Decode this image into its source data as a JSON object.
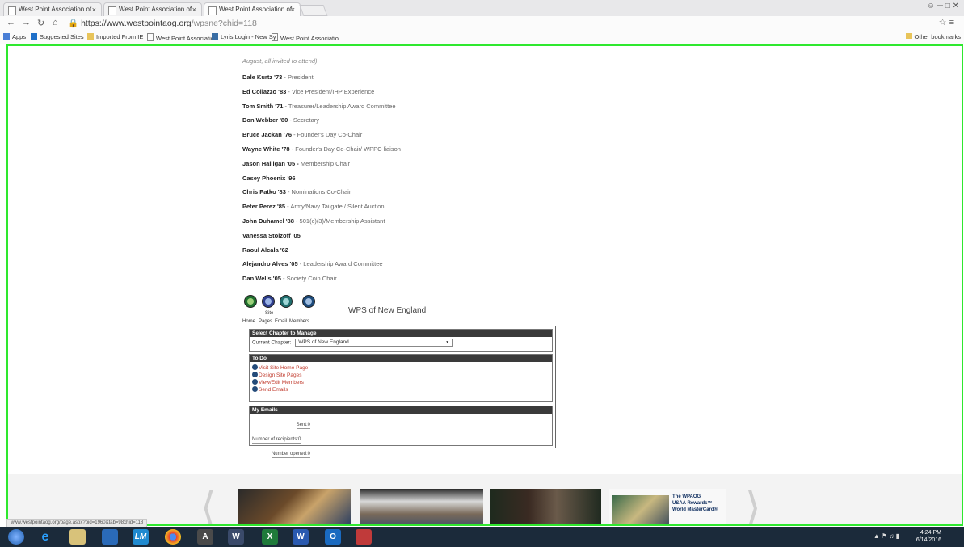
{
  "browser": {
    "tabs": [
      {
        "title": "West Point Association of"
      },
      {
        "title": "West Point Association of"
      },
      {
        "title": "West Point Association of"
      }
    ],
    "tab_close": "×",
    "url": {
      "host": "https://www.westpointaog.org",
      "path": "/wpsne?chid=118"
    },
    "bookmarks": [
      {
        "label": "Apps"
      },
      {
        "label": "Suggested Sites"
      },
      {
        "label": "Imported From IE"
      },
      {
        "label": "West Point Associatio"
      },
      {
        "label": "Lyris Login - New Sy"
      },
      {
        "label": "West Point Associatio"
      }
    ],
    "other_bookmarks": "Other bookmarks"
  },
  "page": {
    "intro": "August, all invited to attend)",
    "members": [
      {
        "name": "Dale Kurtz '73",
        "role": " - President"
      },
      {
        "name": "Ed Collazzo '83",
        "role": " - Vice President/IHP Experience"
      },
      {
        "name": "Tom Smith '71",
        "role": " - Treasurer/Leadership Award Committee"
      },
      {
        "name": "Don Webber '80",
        "role": " - Secretary"
      },
      {
        "name": "Bruce Jackan '76",
        "role": " - Founder's Day Co-Chair"
      },
      {
        "name": "Wayne White '78",
        "role": " - Founder's Day Co-Chair/ WPPC liaison"
      },
      {
        "name": "Jason Halligan '05 -",
        "role": " Membership Chair"
      },
      {
        "name": "Casey Phoenix '96",
        "role": ""
      },
      {
        "name": "Chris Patko '83",
        "role": " - Nominations Co-Chair"
      },
      {
        "name": "Peter Perez '85",
        "role": " - Army/Navy Tailgate / Silent Auction"
      },
      {
        "name": "John Duhamel '88",
        "role": " - 501(c)(3)/Membership Assistant"
      },
      {
        "name": "Vanessa Stolzoff '05",
        "role": ""
      },
      {
        "name": "Raoul Alcala '62",
        "role": ""
      },
      {
        "name": "Alejandro Alves '05",
        "role": " - Leadership Award Committee"
      },
      {
        "name": "Dan Wells '05",
        "role": " - Society Coin Chair"
      }
    ],
    "manage_icons": {
      "site_label": "Site",
      "labels": [
        "Home",
        "Pages",
        "Email",
        "Members"
      ]
    },
    "chapter_name": "WPS of New England",
    "select_panel": {
      "header": "Select Chapter to Manage",
      "current_label": "Current Chapter:",
      "current_value": "WPS of New England"
    },
    "todo_panel": {
      "header": "To Do",
      "items": [
        "Visit Site Home Page",
        "Design Site Pages",
        "View/Edit Members",
        "Send Emails"
      ]
    },
    "emails_panel": {
      "header": "My Emails",
      "rows": [
        {
          "label": "Sent:",
          "value": "0"
        },
        {
          "label": "Number of recipients:",
          "value": "0"
        },
        {
          "label": "Number opened:",
          "value": "0"
        }
      ]
    },
    "card": {
      "line1": "The WPAOG",
      "line2": "USAA Rewards™",
      "line3": "World MasterCard®"
    },
    "status_url": "www.westpointaog.org/page.aspx?pid=1960&tab=98chid=118"
  },
  "taskbar": {
    "apps": [
      "LM",
      "A",
      "W",
      "X",
      "W",
      "O"
    ],
    "time": "4:24 PM",
    "date": "6/14/2016"
  },
  "colors": {
    "viewport_border": "#2ee82e",
    "panel_header": "#3a3a3a",
    "todo_link": "#c0392b"
  }
}
